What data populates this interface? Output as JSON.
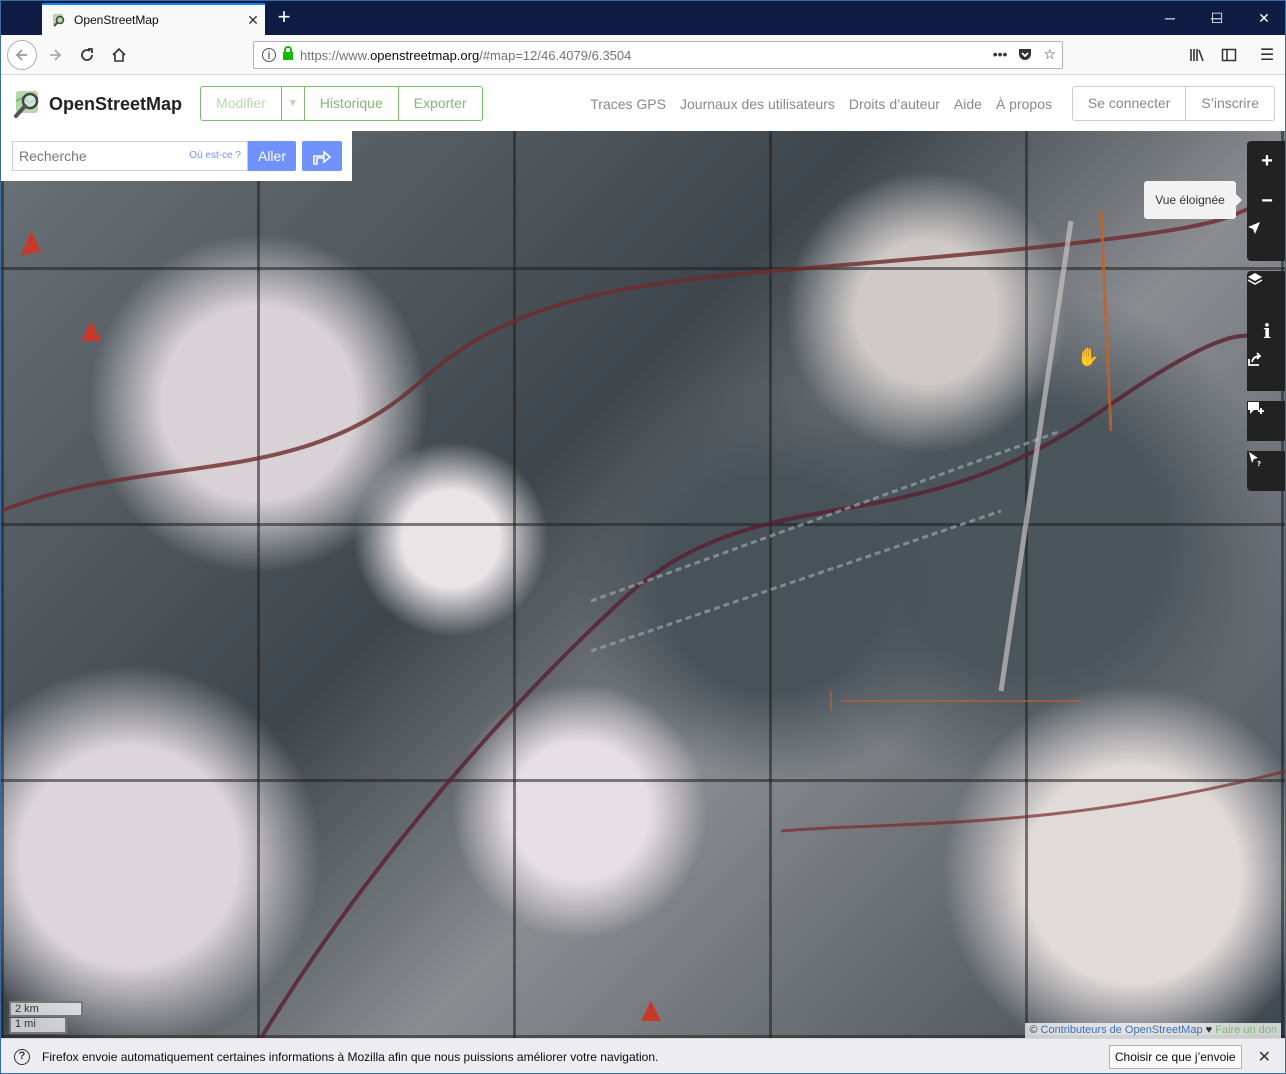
{
  "browser": {
    "tab_title": "OpenStreetMap",
    "new_tab_label": "+",
    "window_controls": {
      "minimize": "─",
      "maximize": "☐",
      "close": "✕"
    },
    "url_prefix": "https://www.",
    "url_host": "openstreetmap.org",
    "url_path": "/#map=12/46.4079/6.3504",
    "url_more": "•••"
  },
  "osm": {
    "brand": "OpenStreetMap",
    "edit_buttons": {
      "modifier": "Modifier",
      "historique": "Historique",
      "exporter": "Exporter"
    },
    "nav_links": [
      "Traces GPS",
      "Journaux des utilisateurs",
      "Droits d’auteur",
      "Aide",
      "À propos"
    ],
    "auth": {
      "login": "Se connecter",
      "signup": "S’inscrire"
    },
    "search": {
      "placeholder": "Recherche",
      "where_hint": "Où est-ce ?",
      "go": "Aller"
    },
    "tooltip": "Vue éloignée",
    "scale": {
      "km": "2 km",
      "mi": "1 mi"
    },
    "attribution": {
      "copy": "©",
      "contributors": "Contributeurs de OpenStreetMap",
      "heart": "♥",
      "donate": "Faire un don"
    }
  },
  "notification": {
    "message": "Firefox envoie automatiquement certaines informations à Mozilla afin que nous puissions améliorer votre navigation.",
    "button": "Choisir ce que j’envoie",
    "close": "✕"
  },
  "colors": {
    "osm_green": "#7ebc6f",
    "search_blue": "#7092ff",
    "firefox_blue": "#0a84ff"
  }
}
